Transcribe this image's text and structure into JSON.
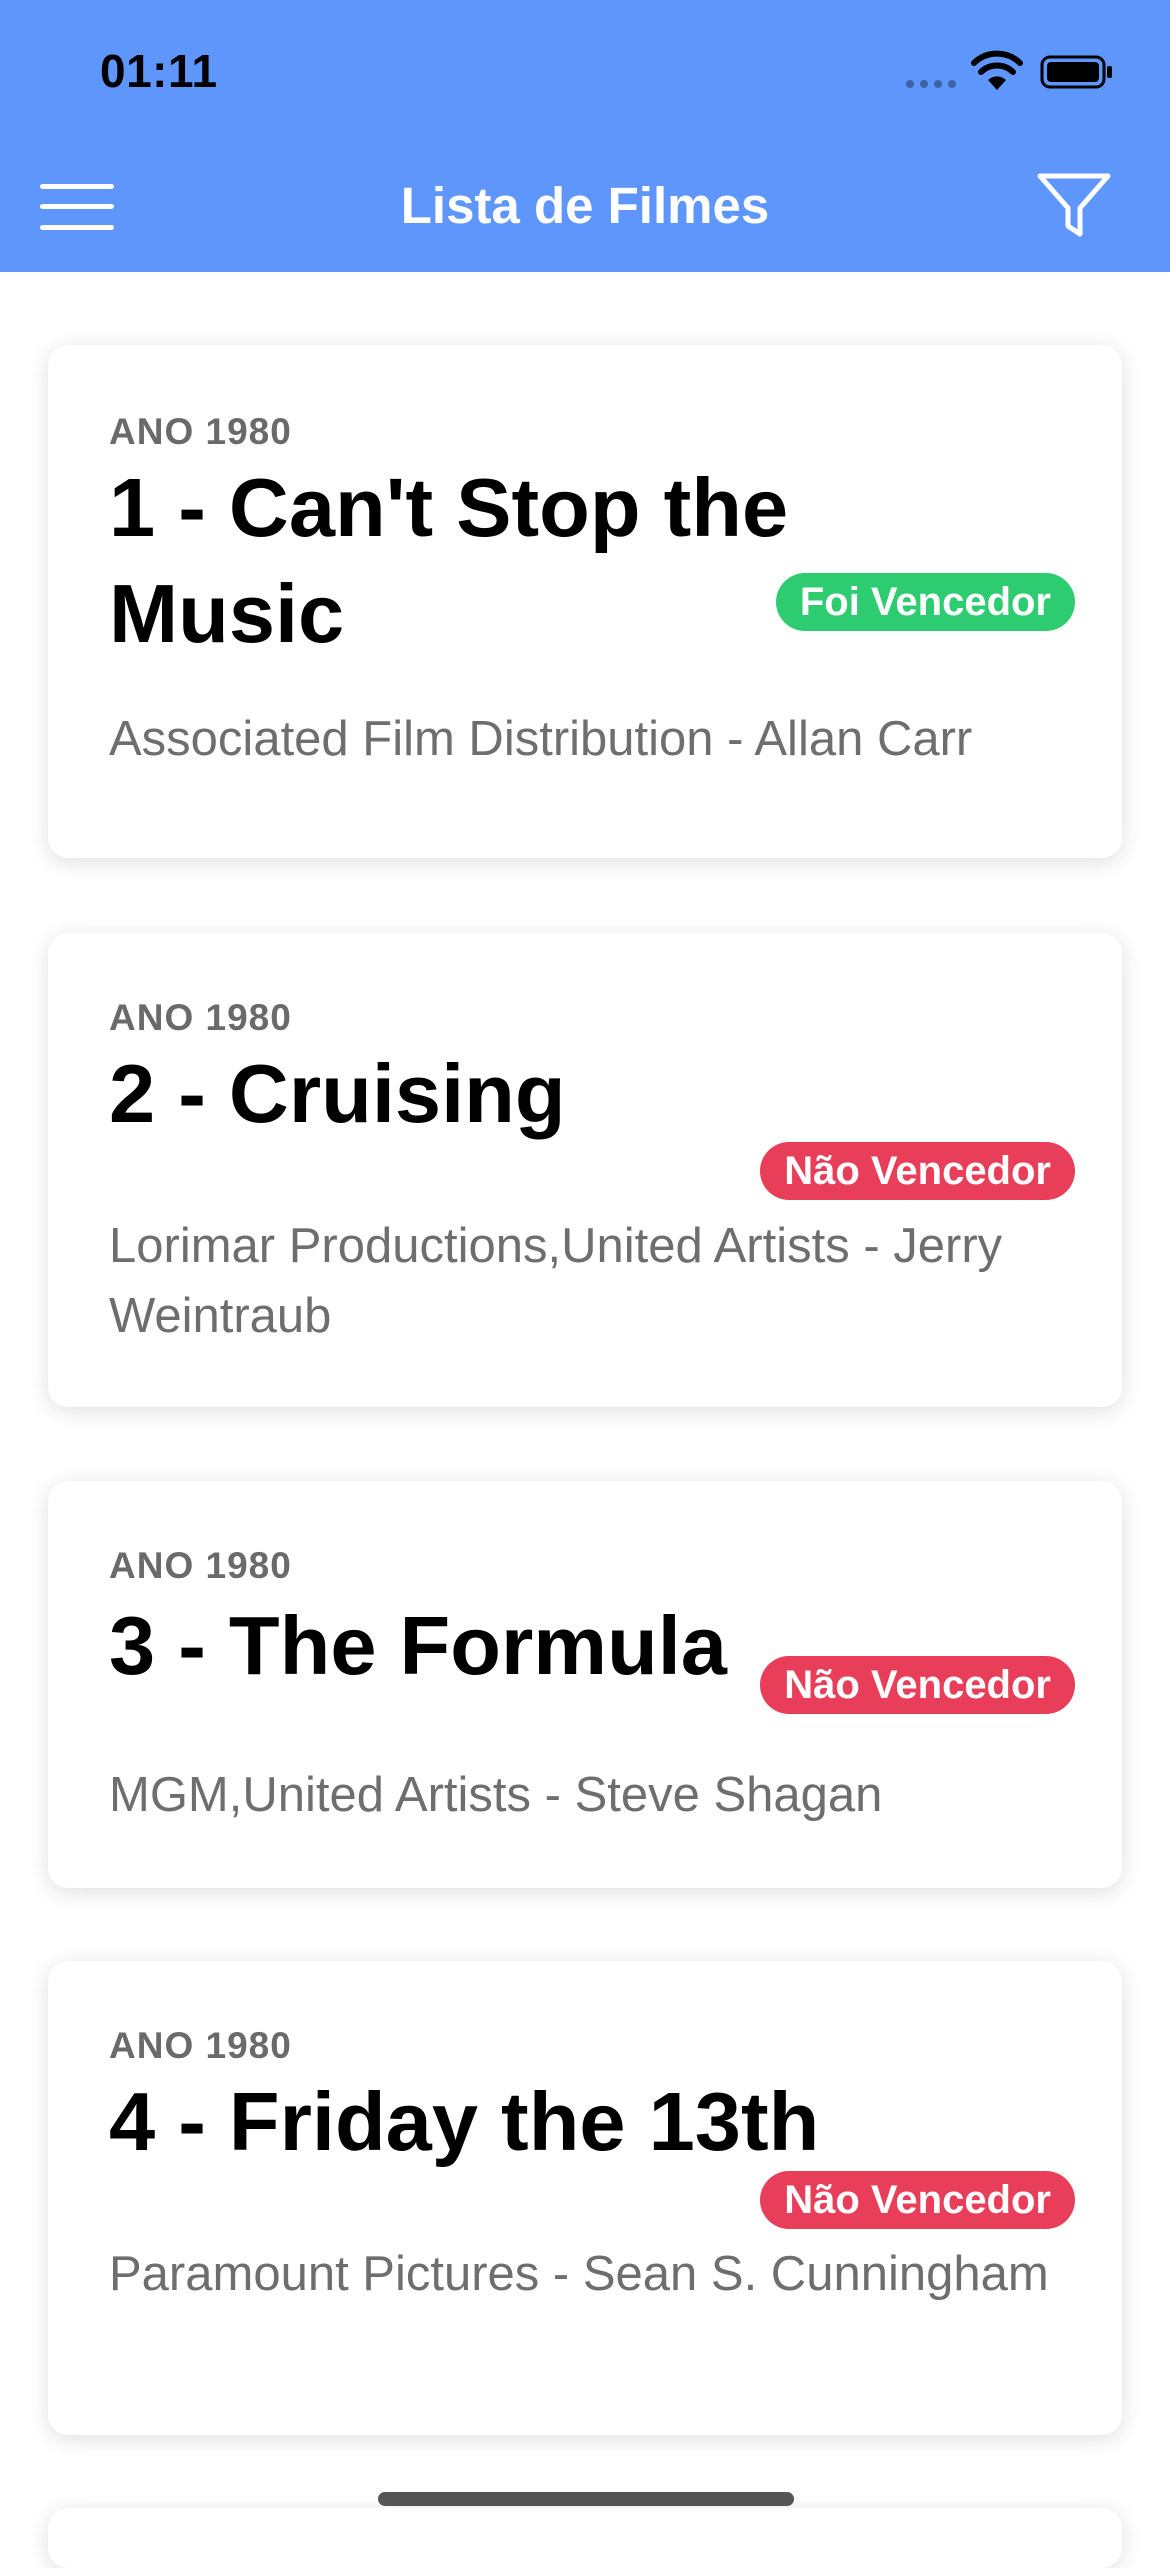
{
  "status_bar": {
    "time": "01:11"
  },
  "nav": {
    "title": "Lista de Filmes",
    "menu_icon": "hamburger-menu-icon",
    "filter_icon": "filter-funnel-icon"
  },
  "colors": {
    "header": "#5e96fb",
    "winner": "#2ecc71",
    "not_winner": "#e83e5a"
  },
  "movies": [
    {
      "year_label": "ANO 1980",
      "title": "1 - Can't Stop the Music",
      "studios_producers": "Associated Film Distribution - Allan Carr",
      "badge": "Foi Vencedor",
      "winner": true
    },
    {
      "year_label": "ANO 1980",
      "title": "2 - Cruising",
      "studios_producers": "Lorimar Productions,United Artists - Jerry Weintraub",
      "badge": "Não Vencedor",
      "winner": false
    },
    {
      "year_label": "ANO 1980",
      "title": "3 - The Formula",
      "studios_producers": "MGM,United Artists - Steve Shagan",
      "badge": "Não Vencedor",
      "winner": false
    },
    {
      "year_label": "ANO 1980",
      "title": "4 - Friday the 13th",
      "studios_producers": "Paramount Pictures - Sean S. Cunningham",
      "badge": "Não Vencedor",
      "winner": false
    }
  ]
}
